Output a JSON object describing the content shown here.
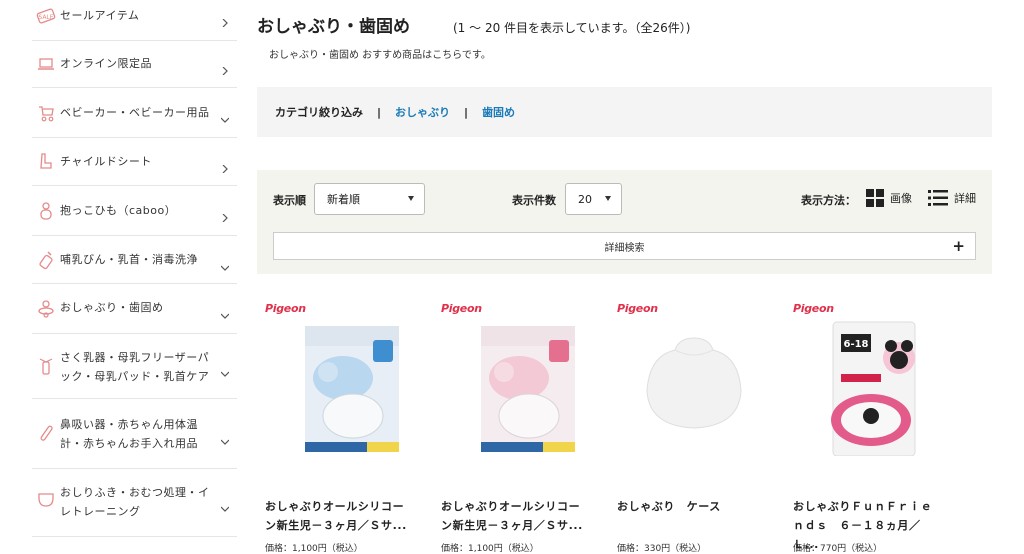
{
  "sidebar": {
    "items": [
      {
        "label": "セールアイテム",
        "icon": "sale-tag-icon",
        "arrow": "chevron-right"
      },
      {
        "label": "オンライン限定品",
        "icon": "laptop-icon",
        "arrow": "chevron-right"
      },
      {
        "label": "ベビーカー・ベビーカー用品",
        "icon": "stroller-icon",
        "arrow": "chevron-down"
      },
      {
        "label": "チャイルドシート",
        "icon": "car-seat-icon",
        "arrow": "chevron-right"
      },
      {
        "label": "抱っこひも（caboo）",
        "icon": "baby-carrier-icon",
        "arrow": "chevron-right"
      },
      {
        "label": "哺乳びん・乳首・消毒洗浄",
        "icon": "baby-bottle-icon",
        "arrow": "chevron-down"
      },
      {
        "label": "おしゃぶり・歯固め",
        "icon": "pacifier-icon",
        "arrow": "chevron-down"
      },
      {
        "label": "さく乳器・母乳フリーザーパック・母乳パッド・乳首ケア",
        "icon": "breast-pump-icon",
        "arrow": "chevron-down"
      },
      {
        "label": "鼻吸い器・赤ちゃん用体温計・赤ちゃんお手入れ用品",
        "icon": "thermometer-icon",
        "arrow": "chevron-down"
      },
      {
        "label": "おしりふき・おむつ処理・イレトレーニング",
        "icon": "diaper-icon",
        "arrow": "chevron-down"
      }
    ]
  },
  "page": {
    "title": "おしゃぶり・歯固め",
    "count_text": "(1 ～ 20 件目を表示しています。（全26件）)",
    "subtitle": "おしゃぶり・歯固め おすすめ商品はこちらです。"
  },
  "category_filter": {
    "label": "カテゴリ絞り込み",
    "separator": "|",
    "links": [
      "おしゃぶり",
      "歯固め"
    ]
  },
  "filters": {
    "sort_label": "表示順",
    "sort_value": "新着順",
    "count_label": "表示件数",
    "count_value": "20",
    "view_label": "表示方法：",
    "view_image": "画像",
    "view_detail": "詳細",
    "detail_search": "詳細検索",
    "detail_search_toggle": "+"
  },
  "products": [
    {
      "brand": "Pigeon",
      "name": "おしゃぶりオールシリコーン新生児－３ヶ月／Ｓサ...",
      "price": "価格：1,100円（税込）"
    },
    {
      "brand": "Pigeon",
      "name": "おしゃぶりオールシリコーン新生児－３ヶ月／Ｓサ...",
      "price": "価格：1,100円（税込）"
    },
    {
      "brand": "Pigeon",
      "name": "おしゃぶり　ケース",
      "price": "価格：330円（税込）"
    },
    {
      "brand": "Pigeon",
      "name": "おしゃぶりＦｕｎＦｒｉｅｎｄｓ　６－１８ヵ月／Ｌ...",
      "price": "価格：770円（税込）"
    }
  ],
  "colors": {
    "accent_link": "#1a7bb9",
    "icon_pink": "#e58a8a",
    "brand_red": "#e0314b"
  }
}
